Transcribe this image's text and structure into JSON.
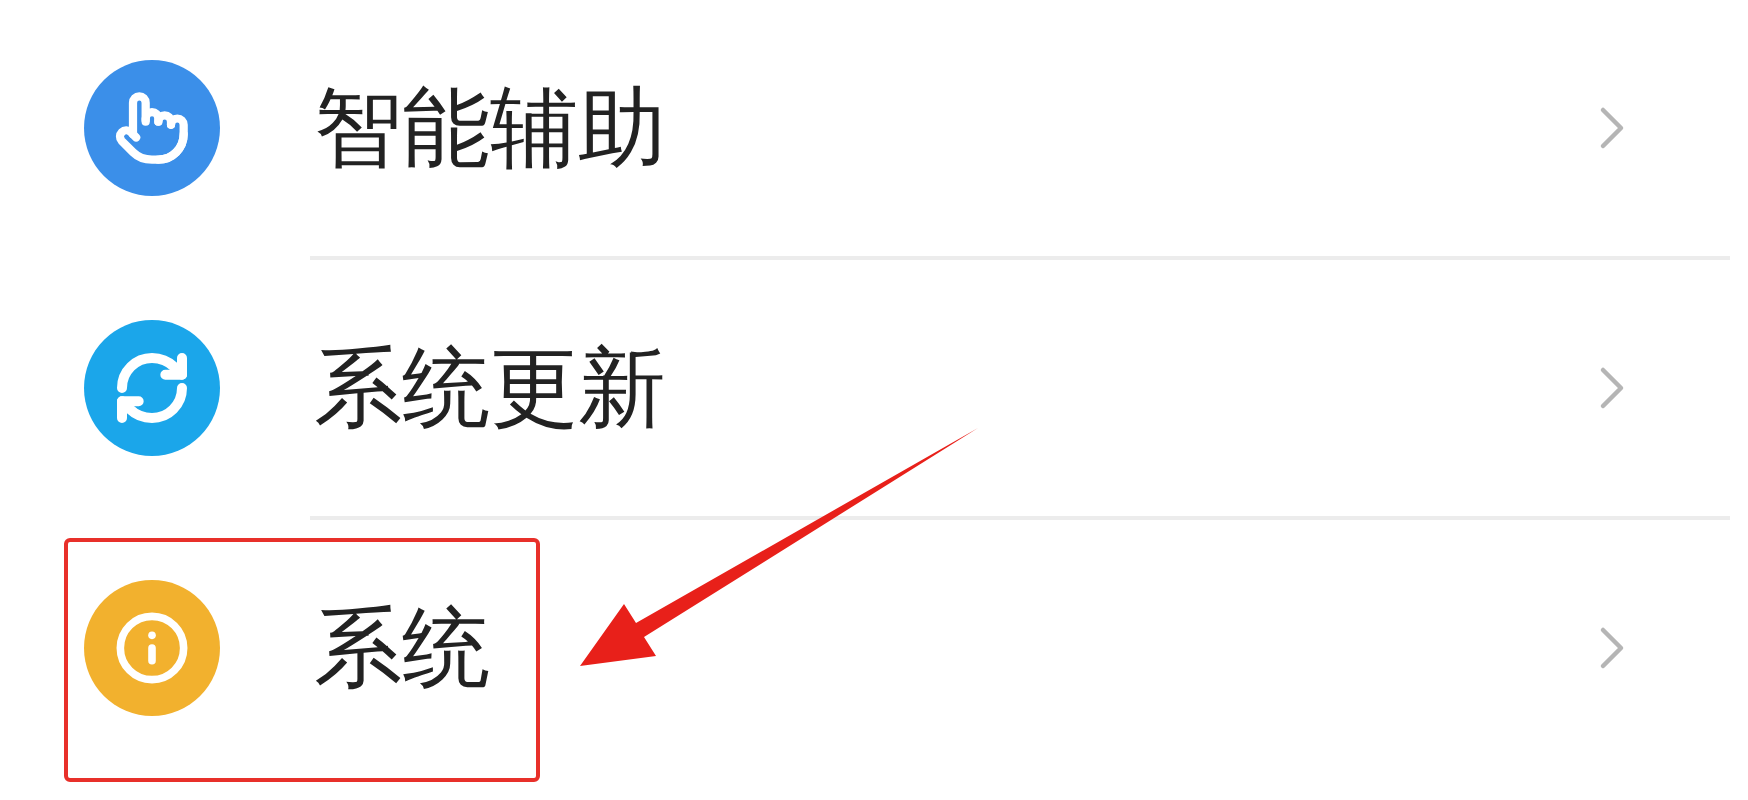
{
  "items": [
    {
      "label": "智能辅助",
      "kind": "touch",
      "color": "#3b8fe9",
      "highlighted": false
    },
    {
      "label": "系统更新",
      "kind": "refresh",
      "color": "#1ba6ea",
      "highlighted": false
    },
    {
      "label": "系统",
      "kind": "info",
      "color": "#f2b12e",
      "highlighted": true
    }
  ]
}
